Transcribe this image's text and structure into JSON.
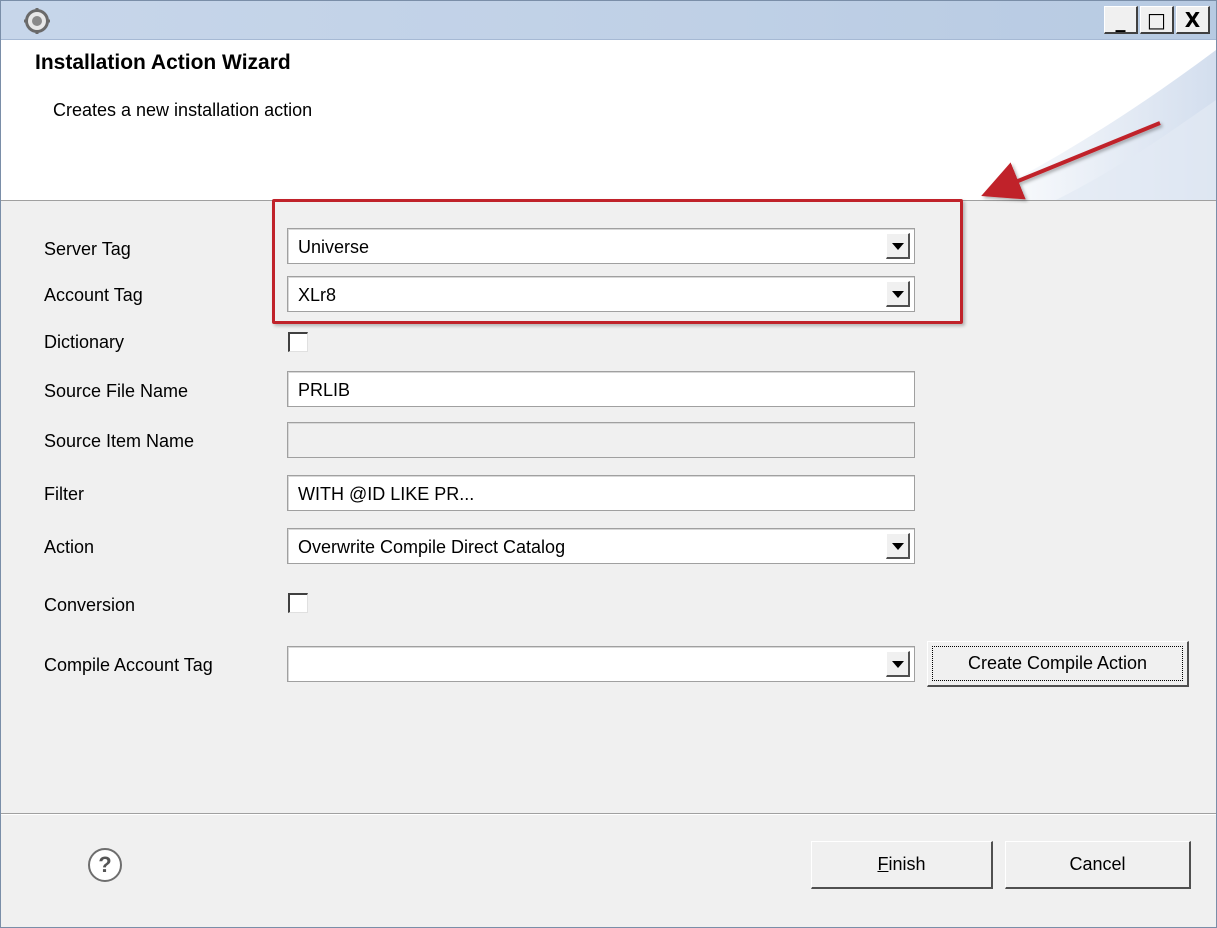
{
  "window": {
    "controls": {
      "minimize": "_",
      "maximize": "□",
      "close": "X"
    }
  },
  "header": {
    "title": "Installation Action Wizard",
    "description": "Creates a new installation action"
  },
  "form": {
    "server_tag": {
      "label": "Server Tag",
      "value": "Universe"
    },
    "account_tag": {
      "label": "Account Tag",
      "value": "XLr8"
    },
    "dictionary": {
      "label": "Dictionary",
      "checked": false
    },
    "source_file_name": {
      "label": "Source File Name",
      "value": "PRLIB"
    },
    "source_item_name": {
      "label": "Source Item Name",
      "value": ""
    },
    "filter": {
      "label": "Filter",
      "value": "WITH @ID LIKE PR..."
    },
    "action": {
      "label": "Action",
      "value": "Overwrite Compile Direct Catalog"
    },
    "conversion": {
      "label": "Conversion",
      "checked": false
    },
    "compile_account_tag": {
      "label": "Compile Account Tag",
      "value": ""
    },
    "create_compile_action": "Create Compile Action"
  },
  "footer": {
    "help_icon": "?",
    "finish_mnemonic": "F",
    "finish_rest": "inish",
    "cancel": "Cancel"
  },
  "annotation": {
    "color": "#c0222a"
  }
}
